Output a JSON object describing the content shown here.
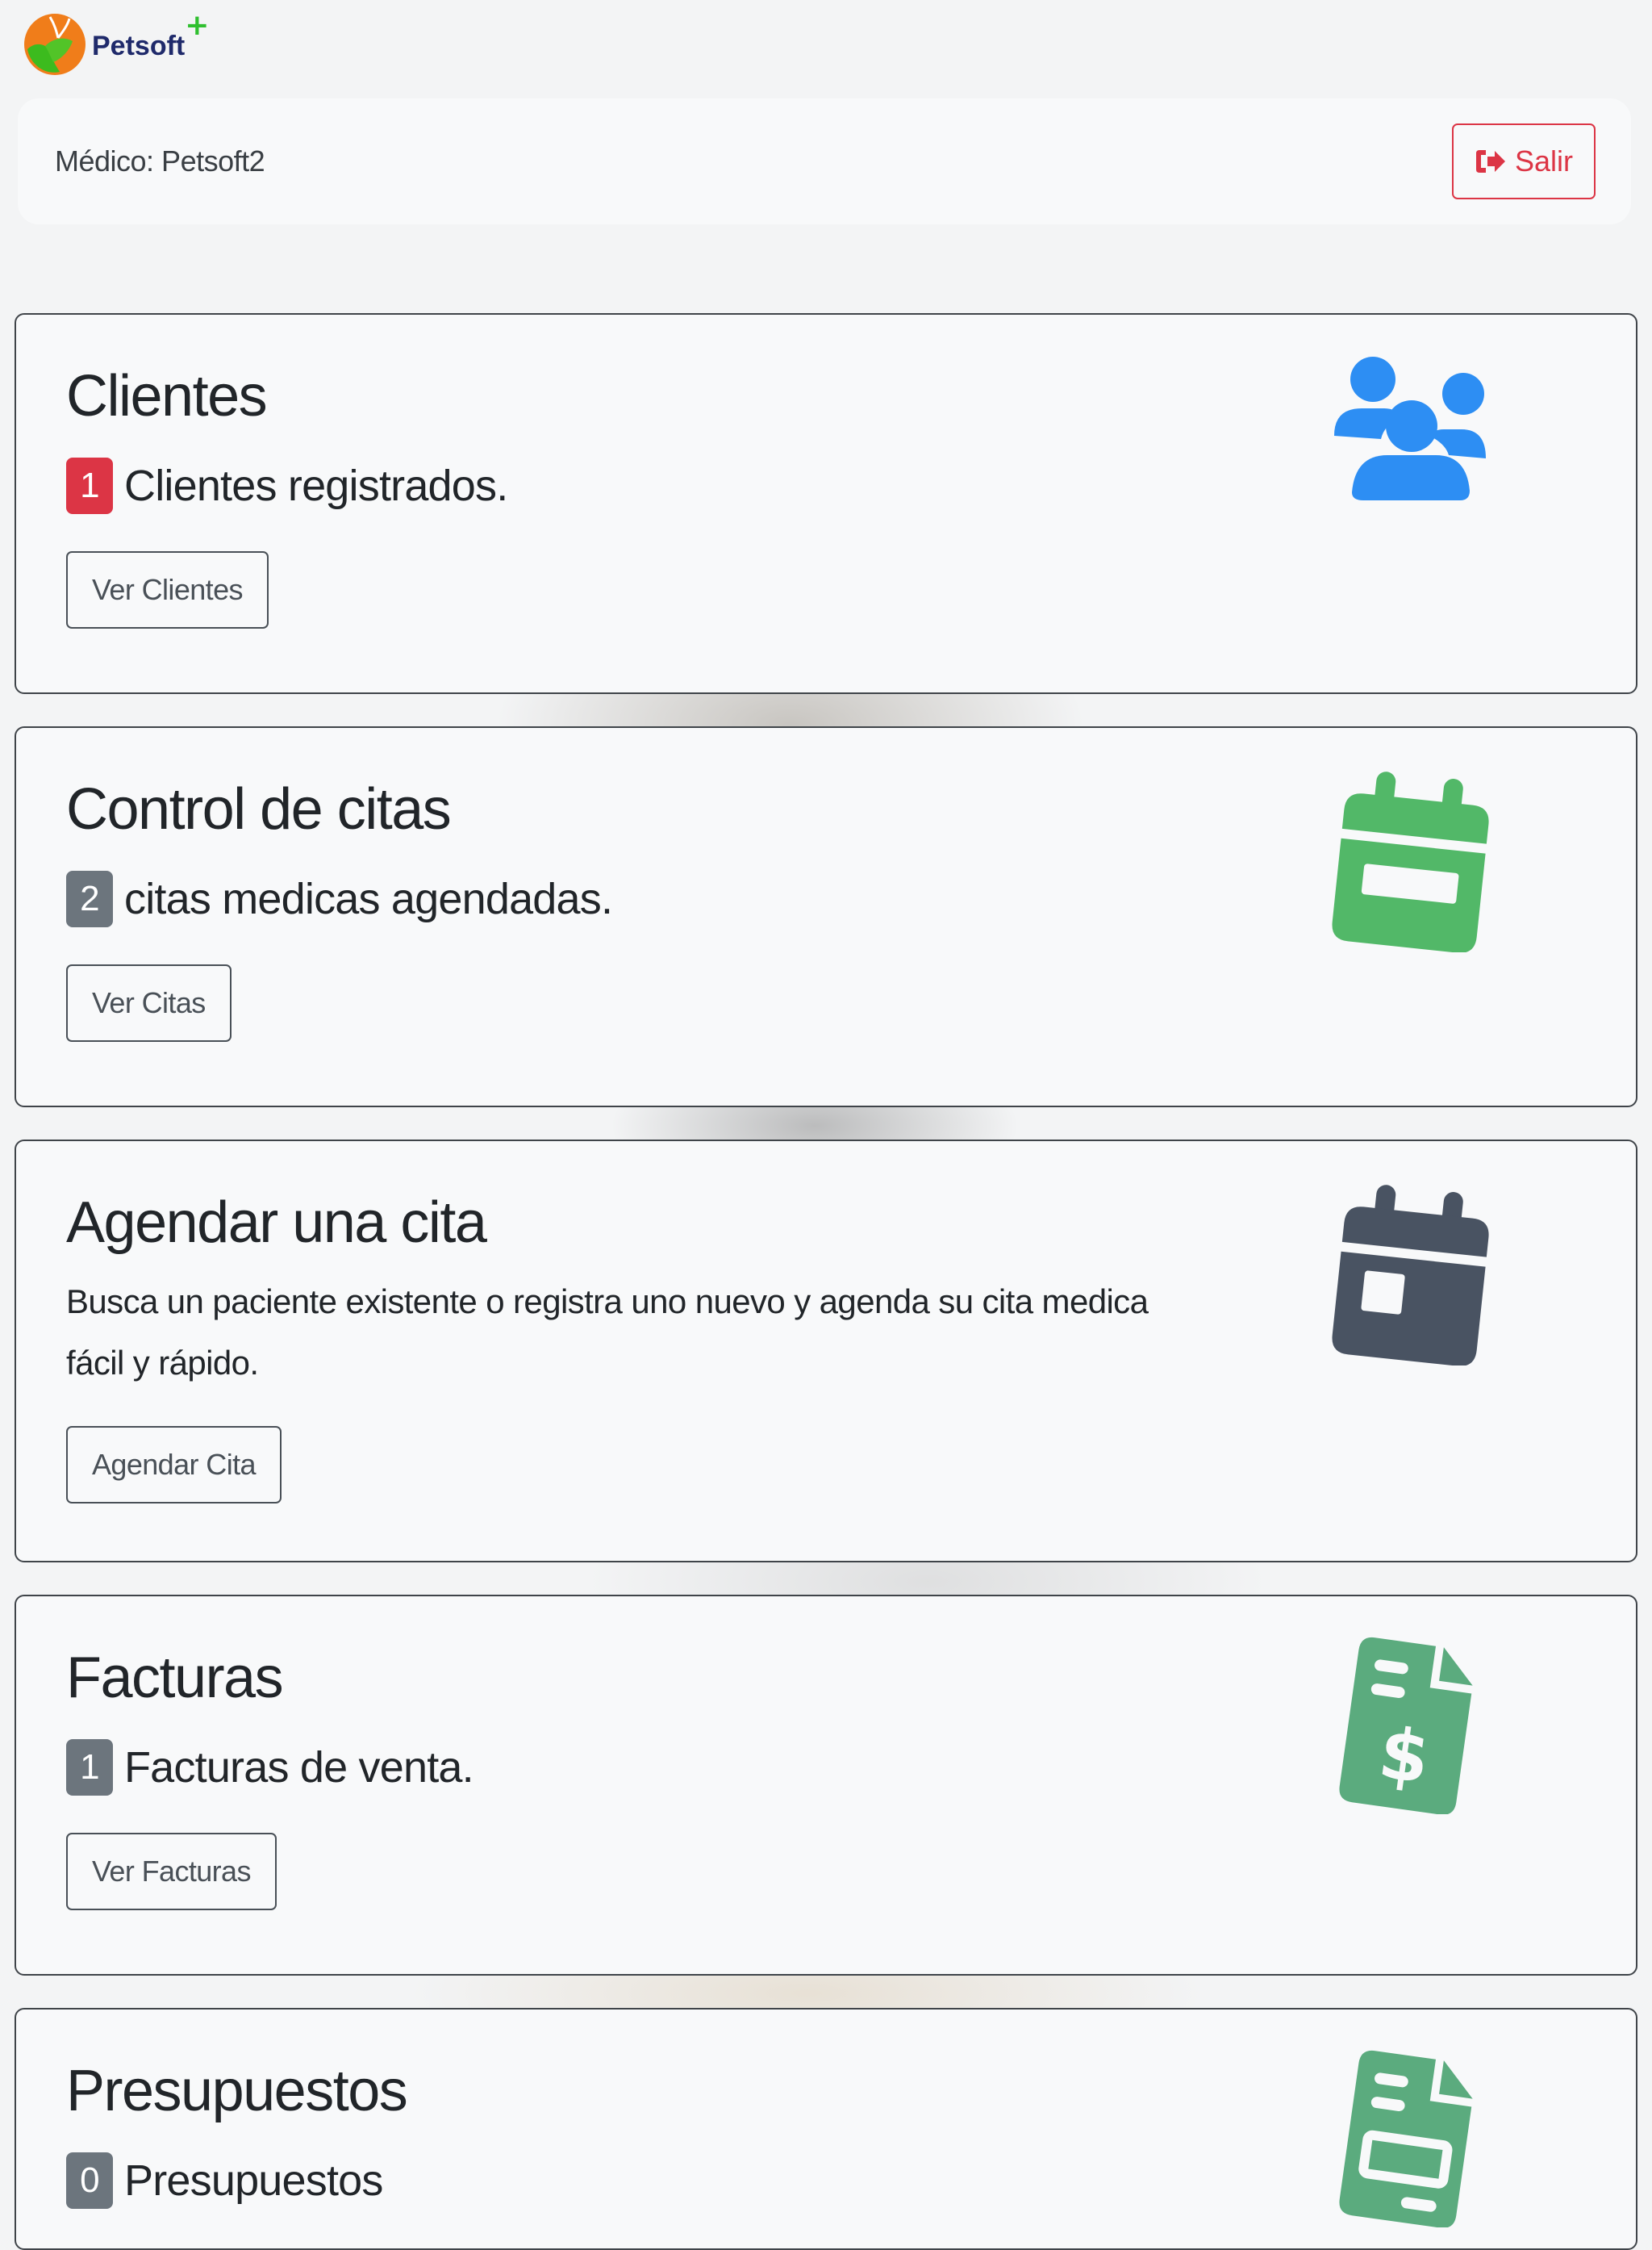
{
  "brand": {
    "name": "Petsoft",
    "plus": "+"
  },
  "navbar": {
    "doctor_label": "Médico: Petsoft2",
    "logout_label": "Salir"
  },
  "cards": [
    {
      "title": "Clientes",
      "badge": "1",
      "badge_color": "#dc3545",
      "subtitle": "Clientes registrados.",
      "button": "Ver Clientes",
      "icon": "users-icon",
      "icon_color": "#2d8ef3"
    },
    {
      "title": "Control de citas",
      "badge": "2",
      "badge_color": "#6c757d",
      "subtitle": "citas medicas agendadas.",
      "button": "Ver Citas",
      "icon": "calendar-icon",
      "icon_color": "#52b868"
    },
    {
      "title": "Agendar una cita",
      "text": "Busca un paciente existente o registra uno nuevo y agenda su cita medica fácil y rápido.",
      "button": "Agendar Cita",
      "icon": "calendar-day-icon",
      "icon_color": "#495362"
    },
    {
      "title": "Facturas",
      "badge": "1",
      "badge_color": "#6c757d",
      "subtitle": "Facturas de venta.",
      "button": "Ver Facturas",
      "icon": "invoice-dollar-icon",
      "icon_color": "#5bab7e"
    },
    {
      "title": "Presupuestos",
      "badge": "0",
      "badge_color": "#6c757d",
      "subtitle": "Presupuestos",
      "icon": "invoice-icon",
      "icon_color": "#5bab7e"
    }
  ]
}
